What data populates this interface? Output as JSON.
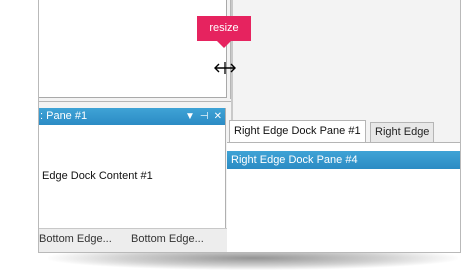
{
  "callout": {
    "label": "resize"
  },
  "left_pane": {
    "title": ": Pane #1",
    "content": "Edge Dock Content #1",
    "buttons": {
      "dropdown": "▼",
      "pin": "⊣",
      "close": "✕"
    }
  },
  "bottom_tabs": [
    "Bottom Edge...",
    "Bottom Edge..."
  ],
  "right_tabs": [
    "Right Edge Dock Pane #1",
    "Right Edge"
  ],
  "right_pane": {
    "title": "Right Edge Dock Pane #4"
  },
  "colors": {
    "accent": "#2b8bc4",
    "callout": "#e6235f"
  },
  "icons": {
    "resize": "resize-horizontal-icon"
  }
}
